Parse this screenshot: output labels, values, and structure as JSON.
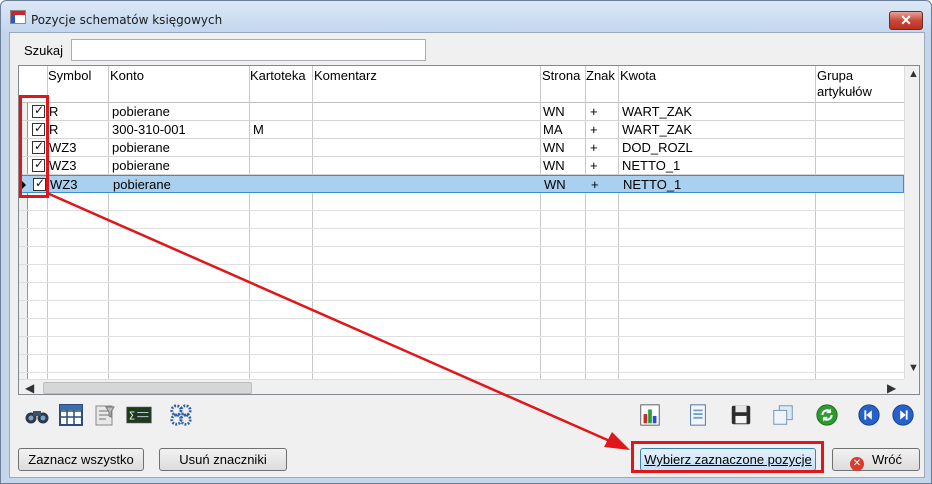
{
  "window": {
    "title": "Pozycje schematów księgowych",
    "close_label": "✕"
  },
  "search": {
    "label": "Szukaj",
    "value": "",
    "placeholder": ""
  },
  "grid": {
    "columns": [
      "Symbol",
      "Konto",
      "Kartoteka",
      "Komentarz",
      "Strona",
      "Znak",
      "Kwota",
      "Grupa\nartykułów"
    ],
    "rows": [
      {
        "checked": true,
        "symbol": "R",
        "konto": "pobierane",
        "kartoteka": "",
        "komentarz": "",
        "strona": "WN",
        "znak": "+",
        "kwota": "WART_ZAK",
        "grupa": ""
      },
      {
        "checked": true,
        "symbol": "R",
        "konto": "300-310-001",
        "kartoteka": "M",
        "komentarz": "",
        "strona": "MA",
        "znak": "+",
        "kwota": "WART_ZAK",
        "grupa": ""
      },
      {
        "checked": true,
        "symbol": "WZ3",
        "konto": "pobierane",
        "kartoteka": "",
        "komentarz": "",
        "strona": "WN",
        "znak": "+",
        "kwota": "DOD_ROZL",
        "grupa": ""
      },
      {
        "checked": true,
        "symbol": "WZ3",
        "konto": "pobierane",
        "kartoteka": "",
        "komentarz": "",
        "strona": "WN",
        "znak": "+",
        "kwota": "NETTO_1",
        "grupa": ""
      },
      {
        "checked": true,
        "symbol": "WZ3",
        "konto": "pobierane",
        "kartoteka": "",
        "komentarz": "",
        "strona": "WN",
        "znak": "+",
        "kwota": "NETTO_1",
        "grupa": "",
        "selected": true
      }
    ]
  },
  "toolbar": {
    "left_icons": [
      "binoculars-icon",
      "calculator-grid-icon",
      "filter-sheet-icon",
      "formula-icon",
      "gears-icon"
    ],
    "right_icons": [
      "bar-chart-icon",
      "document-icon",
      "save-icon",
      "copy-icon",
      "refresh-icon",
      "previous-icon",
      "next-icon"
    ]
  },
  "buttons": {
    "select_all": "Zaznacz wszystko",
    "remove_marks": "Usuń znaczniki",
    "choose_selected": "Wybierz zaznaczone pozycje",
    "back": "Wróć"
  },
  "colors": {
    "highlight": "#e0161b",
    "selection": "#a9d0ee"
  }
}
